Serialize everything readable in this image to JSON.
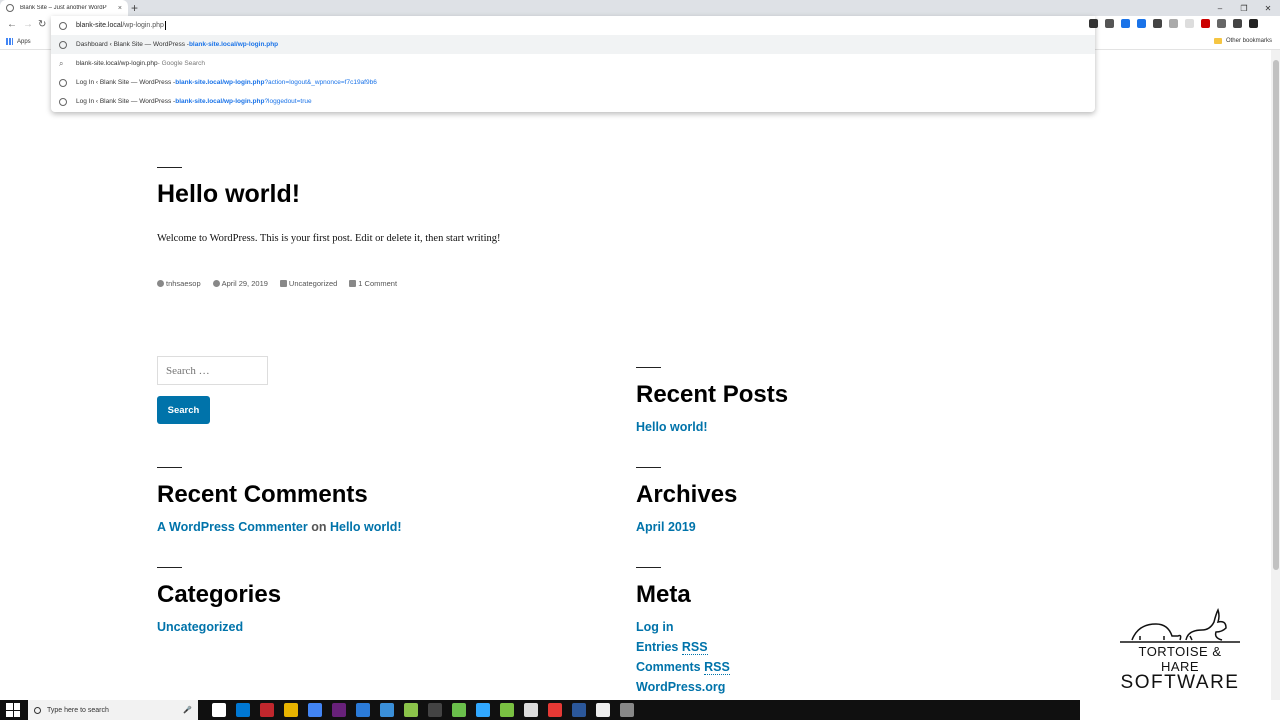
{
  "browser": {
    "tab_title": "Blank Site – Just another WordP",
    "tab_close": "×",
    "new_tab": "+",
    "window_controls": [
      "–",
      "❐",
      "✕"
    ],
    "omnibox": {
      "typed": "blank-site.local",
      "autocomplete": "/wp-login.php"
    },
    "suggestions": [
      {
        "pre": "Dashboard ‹ Blank Site — WordPress - ",
        "url": "blank-site.local/wp-login.php",
        "query": "",
        "icon": "globe-icon"
      },
      {
        "pre": "blank-site.local/wp-login.php",
        "dim": " - Google Search",
        "url": "",
        "query": "",
        "icon": "search-icon"
      },
      {
        "pre": "Log In ‹ Blank Site — WordPress - ",
        "url": "blank-site.local/wp-login.php",
        "query": "?action=logout&_wpnonce=f7c19af9b6",
        "icon": "globe-icon"
      },
      {
        "pre": "Log In ‹ Blank Site — WordPress - ",
        "url": "blank-site.local/wp-login.php",
        "query": "?loggedout=true",
        "icon": "globe-icon"
      }
    ],
    "bookmarks": {
      "apps": "Apps",
      "other": "Other bookmarks"
    },
    "extension_colors": [
      "#333333",
      "#555555",
      "#1a73e8",
      "#1a73e8",
      "#444444",
      "#aaaaaa",
      "#dddddd",
      "#cc0000",
      "#666666",
      "#444444",
      "#222222"
    ]
  },
  "post": {
    "title": "Hello world!",
    "body": "Welcome to WordPress. This is your first post. Edit or delete it, then start writing!",
    "author": "tnhsaesop",
    "date": "April 29, 2019",
    "category": "Uncategorized",
    "comments": "1 Comment"
  },
  "search": {
    "placeholder": "Search …",
    "button": "Search"
  },
  "widgets": {
    "recent_posts": {
      "title": "Recent Posts",
      "items": [
        "Hello world!"
      ]
    },
    "recent_comments": {
      "title": "Recent Comments",
      "commenter": "A WordPress Commenter",
      "on": "on",
      "post": "Hello world!"
    },
    "archives": {
      "title": "Archives",
      "items": [
        "April 2019"
      ]
    },
    "categories": {
      "title": "Categories",
      "items": [
        "Uncategorized"
      ]
    },
    "meta": {
      "title": "Meta",
      "login": "Log in",
      "entries": "Entries",
      "comments": "Comments",
      "rss": "RSS",
      "wordpress": "WordPress.org"
    }
  },
  "logo": {
    "line1": "TORTOISE & HARE",
    "line2": "SOFTWARE"
  },
  "taskbar": {
    "search_placeholder": "Type here to search",
    "app_colors": [
      "#ffffff",
      "#0078d4",
      "#c1272d",
      "#e8b400",
      "#4285f4",
      "#68217a",
      "#2b7bd8",
      "#3a8fd8",
      "#8bc34a",
      "#444444",
      "#6abf4b",
      "#31a8ff",
      "#7ac142",
      "#dddddd",
      "#e53935",
      "#2b579a",
      "#eeeeee",
      "#888888"
    ]
  }
}
